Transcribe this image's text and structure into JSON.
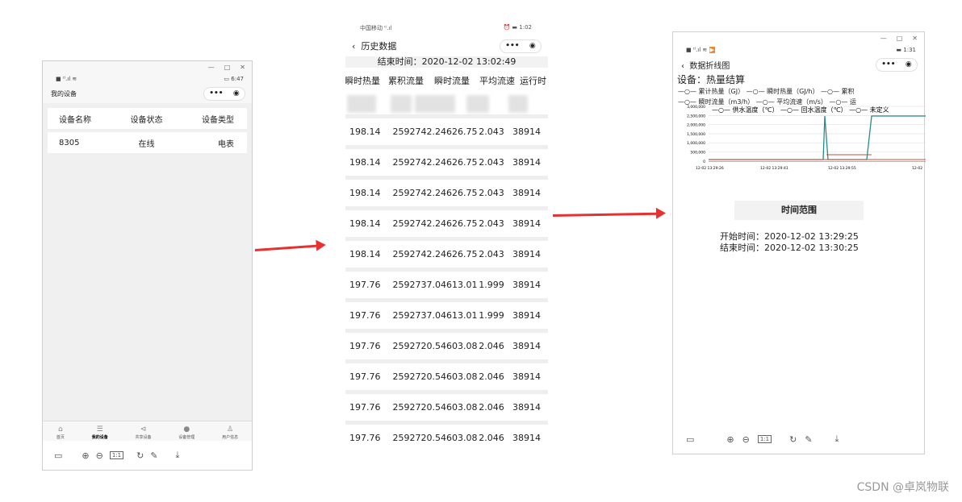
{
  "panel1": {
    "status_time": "6:47",
    "signal": "■ ᵗˡ.ıl ≋",
    "title": "我的设备",
    "table_headers": [
      "设备名称",
      "设备状态",
      "设备类型"
    ],
    "row": [
      "8305",
      "在线",
      "电表"
    ],
    "tabs": [
      {
        "label": "首页",
        "icon": "⌂"
      },
      {
        "label": "我的设备",
        "icon": "☰"
      },
      {
        "label": "共享设备",
        "icon": "⊲"
      },
      {
        "label": "设备管理",
        "icon": "●"
      },
      {
        "label": "用户信息",
        "icon": "♙"
      }
    ],
    "toolbar_zoom": "1:1"
  },
  "panel2": {
    "carrier": "中国移动 ᵗˡ.ıl",
    "status_time": "1:02",
    "title": "历史数据",
    "end_time": "结束时间：2020-12-02 13:02:49",
    "headers": [
      "瞬时热量",
      "累积流量",
      "瞬时流量",
      "平均流速",
      "运行时"
    ],
    "rows": [
      [
        "198.14",
        "2592742.2",
        "4626.75",
        "2.043",
        "38914"
      ],
      [
        "198.14",
        "2592742.2",
        "4626.75",
        "2.043",
        "38914"
      ],
      [
        "198.14",
        "2592742.2",
        "4626.75",
        "2.043",
        "38914"
      ],
      [
        "198.14",
        "2592742.2",
        "4626.75",
        "2.043",
        "38914"
      ],
      [
        "198.14",
        "2592742.2",
        "4626.75",
        "2.043",
        "38914"
      ],
      [
        "197.76",
        "2592737.0",
        "4613.01",
        "1.999",
        "38914"
      ],
      [
        "197.76",
        "2592737.0",
        "4613.01",
        "1.999",
        "38914"
      ],
      [
        "197.76",
        "2592720.5",
        "4603.08",
        "2.046",
        "38914"
      ],
      [
        "197.76",
        "2592720.5",
        "4603.08",
        "2.046",
        "38914"
      ],
      [
        "197.76",
        "2592720.5",
        "4603.08",
        "2.046",
        "38914"
      ],
      [
        "197.76",
        "2592720.5",
        "4603.08",
        "2.046",
        "38914"
      ]
    ]
  },
  "panel3": {
    "status_time": "1:31",
    "title": "数据折线图",
    "device": "设备：热量结算",
    "legend_line1": "—○— 累计热量（GJ）  —○— 瞬时热量（GJ/h）  —○— 累积",
    "legend_line2": "—○— 瞬时流量（m3/h）  —○— 平均流速（m/s）  —○— 运",
    "legend_line3": "—○— 供水温度（℃）  —○— 回水温度（℃）  —○— 未定义",
    "yticks": [
      "3,000,000",
      "2,500,000",
      "2,000,000",
      "1,500,000",
      "1,000,000",
      "500,000",
      "0"
    ],
    "xticks": [
      "12-02 13:29:26",
      "12-02 13:29:41",
      "12-02 13:29:55",
      "12-02"
    ],
    "time_button": "时间范围",
    "start": "开始时间：2020-12-02 13:29:25",
    "end": "结束时间：2020-12-02 13:30:25",
    "toolbar_zoom": "1:1"
  },
  "watermark": "CSDN @卓岚物联"
}
